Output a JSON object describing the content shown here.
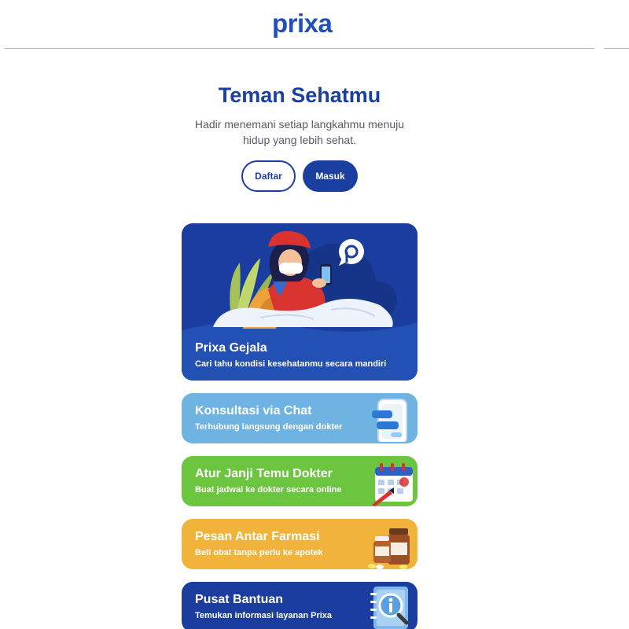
{
  "header": {
    "logo_text": "prixa"
  },
  "hero": {
    "title": "Teman Sehatmu",
    "subtitle": "Hadir menemani setiap langkahmu menuju hidup yang lebih sehat.",
    "register_label": "Daftar",
    "login_label": "Masuk"
  },
  "cards": {
    "gejala": {
      "title": "Prixa Gejala",
      "subtitle": "Cari tahu kondisi kesehatanmu secara mandiri"
    },
    "chat": {
      "title": "Konsultasi via Chat",
      "subtitle": "Terhubung langsung dengan dokter"
    },
    "janji": {
      "title": "Atur Janji Temu Dokter",
      "subtitle": "Buat jadwal ke dokter secara online"
    },
    "farmasi": {
      "title": "Pesan Antar Farmasi",
      "subtitle": "Beli obat tanpa perlu ke apotek"
    },
    "bantuan": {
      "title": "Pusat Bantuan",
      "subtitle": "Temukan informasi layanan Prixa"
    }
  },
  "colors": {
    "brand_blue": "#1a3fa0",
    "chat_card": "#6fb3e3",
    "janji_card": "#6cc53e",
    "farmasi_card": "#f1b339",
    "bantuan_card": "#1b3d9f"
  },
  "icons": [
    "prixa-logo",
    "woman-with-phone-illustration",
    "chat-bubble-icon",
    "phone-chat-icon",
    "calendar-icon",
    "medicine-bottles-icon",
    "help-book-icon"
  ]
}
